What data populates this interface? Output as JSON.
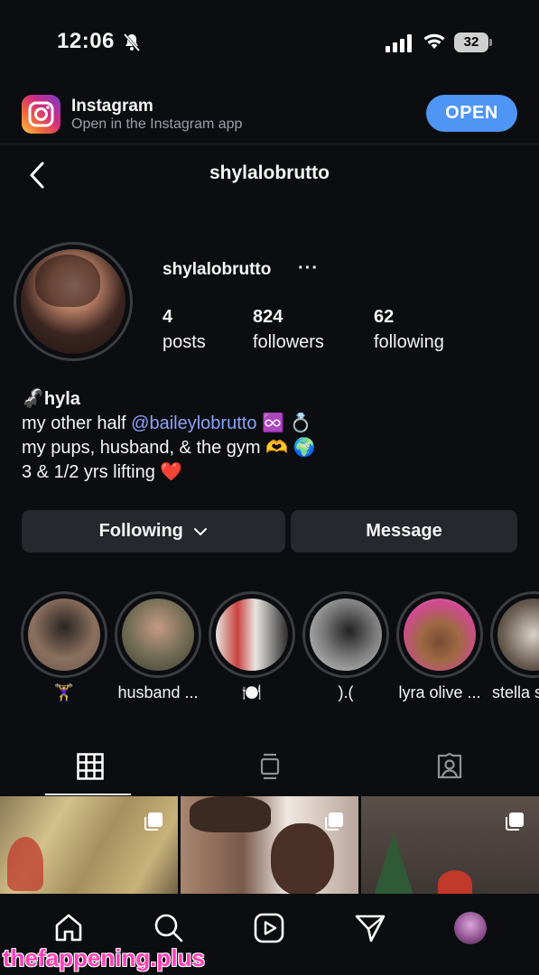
{
  "status_bar": {
    "time": "12:06",
    "battery": "32"
  },
  "app_banner": {
    "title": "Instagram",
    "subtitle": "Open in the Instagram app",
    "open_label": "OPEN"
  },
  "header": {
    "title": "shylalobrutto"
  },
  "profile": {
    "username": "shylalobrutto",
    "more": "···",
    "stats": [
      {
        "value": "4",
        "label": "posts"
      },
      {
        "value": "824",
        "label": "followers"
      },
      {
        "value": "62",
        "label": "following"
      }
    ],
    "bio": {
      "name": "🦨hyla",
      "line1_prefix": "my other half ",
      "mention": "@baileylobrutto",
      "line1_suffix": " ♾️ 💍",
      "line2": "my pups, husband, & the gym 🫶 🌍",
      "line3": "3 & 1/2 yrs lifting ❤️"
    }
  },
  "actions": {
    "following_label": "Following",
    "message_label": "Message"
  },
  "highlights": [
    {
      "label": "🏋️‍♀️",
      "color": "#6b5a4e"
    },
    {
      "label": "husband ...",
      "color": "#5a5a45"
    },
    {
      "label": "🍽️",
      "color": "#b9b4ae"
    },
    {
      "label": ").(",
      "color": "#8a8a8a"
    },
    {
      "label": "lyra olive ...",
      "color": "#c6468a"
    },
    {
      "label": "stella s",
      "color": "#6b5f52"
    }
  ],
  "tabs": [
    {
      "name": "tab-posts-grid",
      "icon": "grid-icon"
    },
    {
      "name": "tab-reels",
      "icon": "reels-icon"
    },
    {
      "name": "tab-tagged",
      "icon": "tagged-icon"
    }
  ],
  "posts": [
    {
      "color": "#b8a26a",
      "icon": "carousel-icon"
    },
    {
      "color": "#6d5548",
      "icon": "carousel-icon"
    },
    {
      "color": "#4c4440",
      "icon": "carousel-icon"
    }
  ],
  "bottom_nav": [
    "home-icon",
    "search-icon",
    "reels-icon",
    "direct-icon",
    "profile-avatar"
  ],
  "watermark": "thefappening.plus"
}
